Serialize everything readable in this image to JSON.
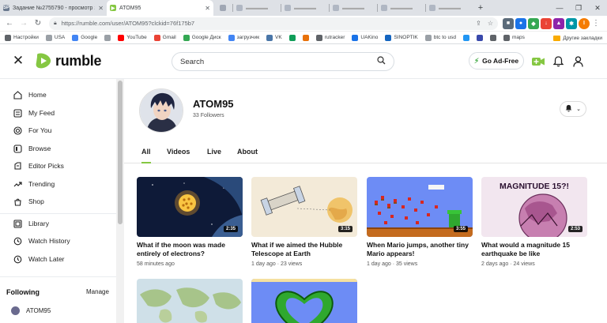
{
  "browser": {
    "tabs": [
      {
        "title": "Задание №2755790 - просмотр з",
        "icon": "sp-icon",
        "active": false
      },
      {
        "title": "ATOM95",
        "icon": "rumble-icon",
        "active": true
      },
      {
        "title": "",
        "icon": "tab-icon"
      },
      {
        "title": "",
        "icon": "tab-icon"
      },
      {
        "title": "",
        "icon": "tab-icon"
      },
      {
        "title": "",
        "icon": "tab-icon"
      },
      {
        "title": "",
        "icon": "tab-icon"
      },
      {
        "title": "",
        "icon": "tab-icon"
      },
      {
        "title": "",
        "icon": "tab-icon"
      },
      {
        "title": "",
        "icon": "tab-icon"
      }
    ],
    "url": "https://rumble.com/user/ATOM95?clckid=76f175b7",
    "bookmarks": [
      {
        "label": "Настройки",
        "color": "#5f6368"
      },
      {
        "label": "USA",
        "color": "#9aa0a6"
      },
      {
        "label": "Google",
        "color": "#4285f4"
      },
      {
        "label": "",
        "color": "#9aa0a6"
      },
      {
        "label": "YouTube",
        "color": "#ff0000"
      },
      {
        "label": "Gmail",
        "color": "#ea4335"
      },
      {
        "label": "Google Диск",
        "color": "#34a853"
      },
      {
        "label": "загрузчик",
        "color": "#4285f4"
      },
      {
        "label": "VK",
        "color": "#4a76a8"
      },
      {
        "label": "",
        "color": "#0f9d58"
      },
      {
        "label": "",
        "color": "#e8710a"
      },
      {
        "label": "rutracker",
        "color": "#5f6368"
      },
      {
        "label": "UAKino",
        "color": "#1a73e8"
      },
      {
        "label": "SINOPTIK",
        "color": "#1565c0"
      },
      {
        "label": "btc to usd",
        "color": "#9aa0a6"
      },
      {
        "label": "",
        "color": "#2196f3"
      },
      {
        "label": "",
        "color": "#3949ab"
      },
      {
        "label": "",
        "color": "#5f6368"
      },
      {
        "label": "maps",
        "color": "#5f6368"
      }
    ],
    "other_bookmarks": "Другие закладки"
  },
  "header": {
    "logo_text": "rumble",
    "search_placeholder": "Search",
    "go_ad_free": "Go Ad-Free"
  },
  "sidebar": {
    "items": [
      {
        "label": "Home",
        "icon": "home-icon"
      },
      {
        "label": "My Feed",
        "icon": "feed-icon"
      },
      {
        "label": "For You",
        "icon": "for-you-icon"
      },
      {
        "label": "Browse",
        "icon": "browse-icon"
      },
      {
        "label": "Editor Picks",
        "icon": "editor-picks-icon"
      },
      {
        "label": "Trending",
        "icon": "trending-icon"
      },
      {
        "label": "Shop",
        "icon": "shop-icon"
      },
      {
        "label": "Library",
        "icon": "library-icon"
      },
      {
        "label": "Watch History",
        "icon": "history-icon"
      },
      {
        "label": "Watch Later",
        "icon": "watch-later-icon"
      }
    ],
    "following_title": "Following",
    "manage_label": "Manage",
    "subscriptions": [
      {
        "name": "ATOM95"
      }
    ]
  },
  "channel": {
    "name": "ATOM95",
    "followers": "33 Followers",
    "tabs": [
      "All",
      "Videos",
      "Live",
      "About"
    ],
    "active_tab": "All"
  },
  "videos": [
    {
      "title": "What if the moon was made entirely of electrons?",
      "duration": "2:35",
      "time": "58 minutes ago",
      "views": ""
    },
    {
      "title": "What if we aimed the Hubble Telescope at Earth",
      "duration": "3:15",
      "time": "1 day ago",
      "views": "23"
    },
    {
      "title": "When Mario jumps, another tiny Mario appears!",
      "duration": "3:55",
      "time": "1 day ago",
      "views": "35"
    },
    {
      "title": "What would a magnitude 15 earthquake be like",
      "duration": "2:53",
      "time": "2 days ago",
      "views": "24"
    }
  ],
  "thumb_text": {
    "magnitude": "MAGNITUDE 15?!"
  },
  "colors": {
    "rumble_green": "#85c742",
    "text": "#111111"
  }
}
